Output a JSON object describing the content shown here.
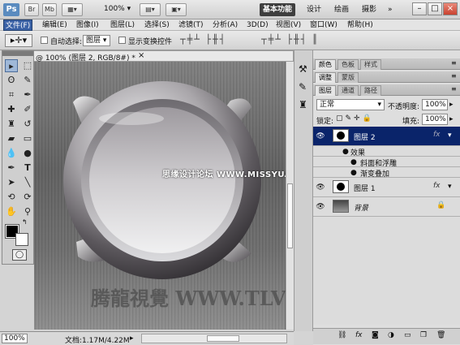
{
  "app": {
    "logo": "Ps",
    "title_buttons": [
      "Br",
      "Mb"
    ],
    "zoom": "100%",
    "workspaces": [
      "基本功能",
      "设计",
      "绘画",
      "摄影"
    ],
    "more": "»"
  },
  "window_controls": [
    "–",
    "□",
    "×"
  ],
  "menu": [
    "文件(F)",
    "编辑(E)",
    "图像(I)",
    "图层(L)",
    "选择(S)",
    "滤镜(T)",
    "分析(A)",
    "3D(D)",
    "视图(V)",
    "窗口(W)",
    "帮助(H)"
  ],
  "options": {
    "auto_select_label": "自动选择:",
    "auto_select_value": "图层",
    "show_transform_label": "显示变换控件"
  },
  "document": {
    "tab_title": "@ 100% (图层 2, RGB/8#) *",
    "tab_close": "×",
    "watermark_top": "思缘设计论坛 WWW.MISSYUAN.COM",
    "watermark_bottom": "腾龍視覺 WWW.TLVI.NET"
  },
  "status": {
    "zoom": "100%",
    "doc_info": "文档:1.17M/4.22M"
  },
  "panels": {
    "group1_tabs": [
      "颜色",
      "色板",
      "样式"
    ],
    "group2_tabs": [
      "调整",
      "蒙版"
    ],
    "layers_tabs": [
      "图层",
      "通道",
      "路径"
    ],
    "blend_mode": "正常",
    "opacity_label": "不透明度:",
    "opacity_value": "100%",
    "lock_label": "锁定:",
    "fill_label": "填充:",
    "fill_value": "100%",
    "layers": [
      {
        "name": "图层 2",
        "fx": "fx"
      },
      {
        "name": "效果"
      },
      {
        "name": "斜面和浮雕"
      },
      {
        "name": "渐变叠加"
      },
      {
        "name": "图层 1",
        "fx": "fx"
      },
      {
        "name": "背景"
      }
    ],
    "bottom_icons": [
      "link-icon",
      "fx-icon",
      "mask-icon",
      "adjustment-icon",
      "folder-icon",
      "new-layer-icon",
      "trash-icon"
    ]
  }
}
